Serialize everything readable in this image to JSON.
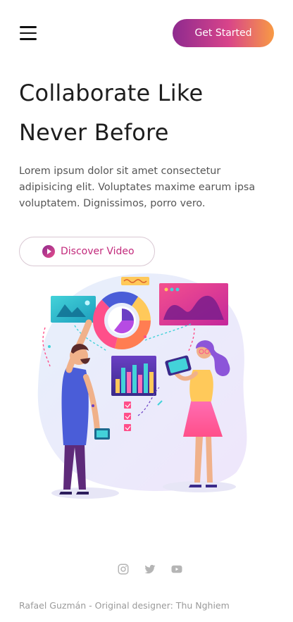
{
  "header": {
    "menu_icon": "hamburger-menu-icon",
    "cta_label": "Get Started"
  },
  "hero": {
    "title_line1": "Collaborate Like",
    "title_line2": "Never Before",
    "description": "Lorem ipsum dolor sit amet consectetur adipisicing elit. Voluptates maxime earum ipsa voluptatem. Dignissimos, porro vero.",
    "video_button_label": "Discover Video",
    "video_icon": "play-icon"
  },
  "footer": {
    "socials": [
      "instagram-icon",
      "twitter-icon",
      "youtube-icon"
    ],
    "credit": "Rafael Guzmán - Original designer: Thu Nghiem"
  },
  "colors": {
    "gradient_start": "#8e2a8f",
    "gradient_mid": "#d8448a",
    "gradient_end": "#f89a44",
    "accent_text": "#c2297b"
  }
}
